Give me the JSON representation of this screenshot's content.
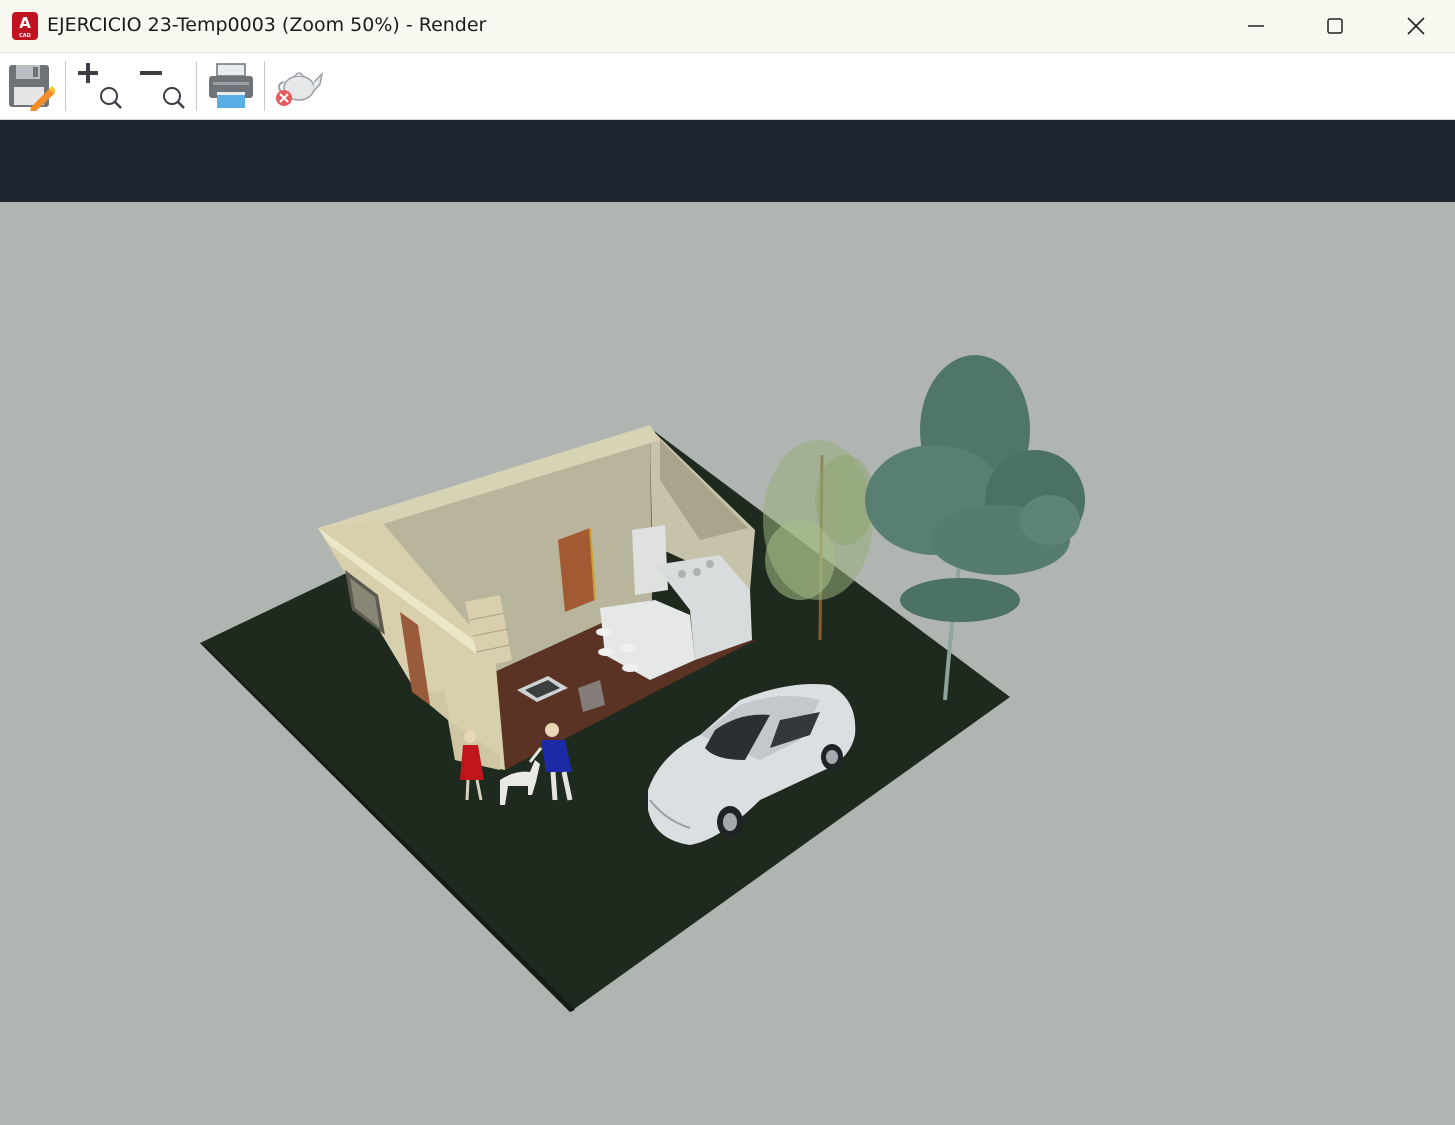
{
  "window": {
    "title": "EJERCICIO 23-Temp0003 (Zoom 50%) - Render",
    "app_icon_letter": "A",
    "app_icon_sub": "CAD",
    "controls": {
      "minimize_icon": "minimize-icon",
      "maximize_icon": "maximize-icon",
      "close_icon": "close-icon"
    }
  },
  "toolbar": {
    "buttons": [
      {
        "name": "save-button",
        "icon": "save-floppy-icon"
      },
      {
        "name": "zoom-in-button",
        "icon": "zoom-in-icon"
      },
      {
        "name": "zoom-out-button",
        "icon": "zoom-out-icon"
      },
      {
        "name": "print-button",
        "icon": "printer-icon"
      },
      {
        "name": "cancel-render-button",
        "icon": "teapot-cancel-icon"
      }
    ]
  },
  "render": {
    "background_color": "#b0b5b1",
    "band_color": "#1f262f",
    "scene": [
      "ground-plane",
      "house",
      "small-tree",
      "large-tree",
      "car",
      "person-woman",
      "person-man",
      "dog"
    ]
  }
}
